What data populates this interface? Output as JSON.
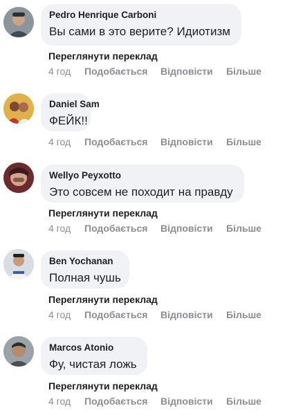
{
  "actions": {
    "translate_label": "Переглянути переклад",
    "like_label": "Подобається",
    "reply_label": "Відповісти",
    "more_label": "Більше"
  },
  "comments": [
    {
      "author": "Pedro Henrique Carboni",
      "text": "Вы сами в это верите? Идиотизм",
      "time": "4 год"
    },
    {
      "author": "Daniel Sam",
      "text": "ФЕЙК!!",
      "time": "4 год"
    },
    {
      "author": "Wellyo Peyxotto",
      "text": "Это совсем не походит на правду",
      "time": "4 год"
    },
    {
      "author": "Ben Yochanan",
      "text": "Полная чушь",
      "time": "4 год"
    },
    {
      "author": "Marcos Atonio",
      "text": "Фу, чистая ложь",
      "time": "4 год"
    }
  ]
}
